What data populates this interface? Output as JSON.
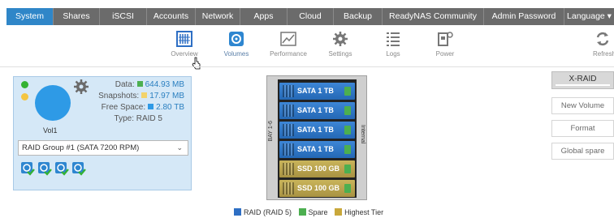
{
  "topnav": {
    "tabs": [
      {
        "label": "System",
        "active": true
      },
      {
        "label": "Shares",
        "active": false
      },
      {
        "label": "iSCSI",
        "active": false
      },
      {
        "label": "Accounts",
        "active": false
      },
      {
        "label": "Network",
        "active": false
      },
      {
        "label": "Apps",
        "active": false
      },
      {
        "label": "Cloud",
        "active": false
      },
      {
        "label": "Backup",
        "active": false
      },
      {
        "label": "ReadyNAS Community",
        "active": false
      },
      {
        "label": "Admin Password",
        "active": false
      },
      {
        "label": "Language ▾",
        "active": false
      }
    ]
  },
  "subnav": {
    "items": [
      {
        "label": "Overview",
        "icon": "overview-icon"
      },
      {
        "label": "Volumes",
        "icon": "volumes-icon",
        "active": true
      },
      {
        "label": "Performance",
        "icon": "performance-icon"
      },
      {
        "label": "Settings",
        "icon": "settings-icon"
      },
      {
        "label": "Logs",
        "icon": "logs-icon"
      },
      {
        "label": "Power",
        "icon": "power-icon"
      },
      {
        "label": "Refresh",
        "icon": "refresh-icon"
      }
    ]
  },
  "volume": {
    "name": "Vol1",
    "data_label": "Data:",
    "data_value": "644.93 MB",
    "snapshots_label": "Snapshots:",
    "snapshots_value": "17.97 MB",
    "free_label": "Free Space:",
    "free_value": "2.80 TB",
    "type_label": "Type:",
    "type_value": "RAID 5",
    "raid_group": "RAID Group #1 (SATA 7200 RPM)",
    "colors": {
      "data": "#4caf50",
      "snapshots": "#f3d36b",
      "free": "#2e9ae6",
      "status_green": "#33b233",
      "status_yellow": "#f4c542"
    }
  },
  "chassis": {
    "left_label": "BAY 1-6",
    "right_label": "Internal",
    "bays": [
      {
        "label": "SATA 1 TB",
        "kind": "raid"
      },
      {
        "label": "SATA 1 TB",
        "kind": "raid"
      },
      {
        "label": "SATA 1 TB",
        "kind": "raid"
      },
      {
        "label": "SATA 1 TB",
        "kind": "raid"
      },
      {
        "label": "SSD 100 GB",
        "kind": "ssd"
      },
      {
        "label": "SSD 100 GB",
        "kind": "ssd"
      }
    ]
  },
  "legend": {
    "raid": "RAID (RAID 5)",
    "spare": "Spare",
    "tier": "Highest Tier",
    "colors": {
      "raid": "#2e6fc4",
      "spare": "#4caf50",
      "tier": "#c9a83b"
    }
  },
  "actions": {
    "xraid": "X-RAID",
    "new_volume": "New Volume",
    "format": "Format",
    "global_spare": "Global spare"
  }
}
